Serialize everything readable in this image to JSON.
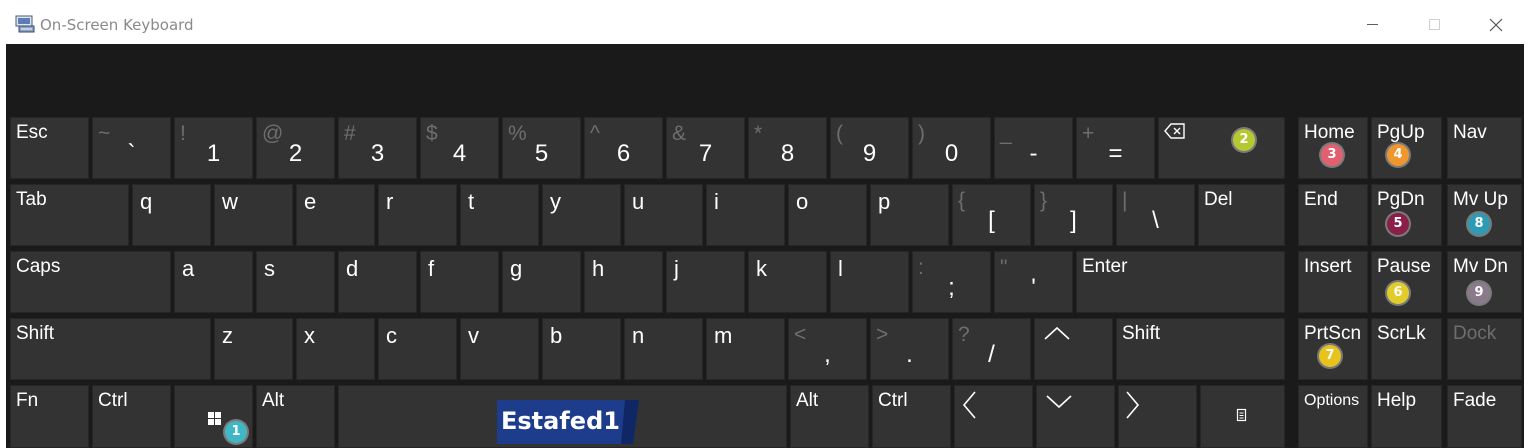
{
  "window": {
    "title": "On-Screen Keyboard",
    "icons": {
      "app": "keyboard-app-icon",
      "minimize": "minimize-icon",
      "maximize": "maximize-icon",
      "close": "close-icon"
    }
  },
  "keys": {
    "esc": "Esc",
    "tilde": {
      "shift": "~",
      "main": "`"
    },
    "k1": {
      "shift": "!",
      "main": "1"
    },
    "k2": {
      "shift": "@",
      "main": "2"
    },
    "k3": {
      "shift": "#",
      "main": "3"
    },
    "k4": {
      "shift": "$",
      "main": "4"
    },
    "k5": {
      "shift": "%",
      "main": "5"
    },
    "k6": {
      "shift": "^",
      "main": "6"
    },
    "k7": {
      "shift": "&",
      "main": "7"
    },
    "k8": {
      "shift": "*",
      "main": "8"
    },
    "k9": {
      "shift": "(",
      "main": "9"
    },
    "k0": {
      "shift": ")",
      "main": "0"
    },
    "minus": {
      "shift": "_",
      "main": "-"
    },
    "equals": {
      "shift": "+",
      "main": "="
    },
    "backspace_icon": "backspace-icon",
    "tab": "Tab",
    "q": "q",
    "w": "w",
    "e": "e",
    "r": "r",
    "t": "t",
    "y": "y",
    "u": "u",
    "i": "i",
    "o": "o",
    "p": "p",
    "lbracket": {
      "shift": "{",
      "main": "["
    },
    "rbracket": {
      "shift": "}",
      "main": "]"
    },
    "backslash": {
      "shift": "|",
      "main": "\\"
    },
    "del": "Del",
    "caps": "Caps",
    "a": "a",
    "s": "s",
    "d": "d",
    "f": "f",
    "g": "g",
    "h": "h",
    "j": "j",
    "k": "k",
    "l": "l",
    "semicolon": {
      "shift": ":",
      "main": ";"
    },
    "quote": {
      "shift": "\"",
      "main": "'"
    },
    "enter": "Enter",
    "shift_left": "Shift",
    "z": "z",
    "x": "x",
    "c": "c",
    "v": "v",
    "b": "b",
    "n": "n",
    "m": "m",
    "comma": {
      "shift": "<",
      "main": ","
    },
    "period": {
      "shift": ">",
      "main": "."
    },
    "slash": {
      "shift": "?",
      "main": "/"
    },
    "up_icon": "arrow-up-icon",
    "shift_right": "Shift",
    "fn": "Fn",
    "ctrl_left": "Ctrl",
    "win_icon": "windows-logo-icon",
    "alt_left": "Alt",
    "alt_right": "Alt",
    "ctrl_right": "Ctrl",
    "left_icon": "arrow-left-icon",
    "down_icon": "arrow-down-icon",
    "right_icon": "arrow-right-icon",
    "menu_icon": "context-menu-icon"
  },
  "nav_keys": {
    "home": "Home",
    "pgup": "PgUp",
    "nav": "Nav",
    "end": "End",
    "pgdn": "PgDn",
    "mvup": "Mv Up",
    "insert": "Insert",
    "pause": "Pause",
    "mvdn": "Mv Dn",
    "prtscn": "PrtScn",
    "scrlk": "ScrLk",
    "dock": "Dock",
    "options": "Options",
    "help": "Help",
    "fade": "Fade"
  },
  "badges": [
    {
      "number": "1",
      "color": "#3fb7c4"
    },
    {
      "number": "2",
      "color": "#b5c832"
    },
    {
      "number": "3",
      "color": "#e06070"
    },
    {
      "number": "4",
      "color": "#f0962e"
    },
    {
      "number": "5",
      "color": "#8a1f4a"
    },
    {
      "number": "6",
      "color": "#e2cc2a"
    },
    {
      "number": "7",
      "color": "#e8c31e"
    },
    {
      "number": "8",
      "color": "#2c9bb3"
    },
    {
      "number": "9",
      "color": "#8a7a8a"
    }
  ],
  "watermark": {
    "text": "Estafed1",
    "color": "#1d3c8c"
  }
}
